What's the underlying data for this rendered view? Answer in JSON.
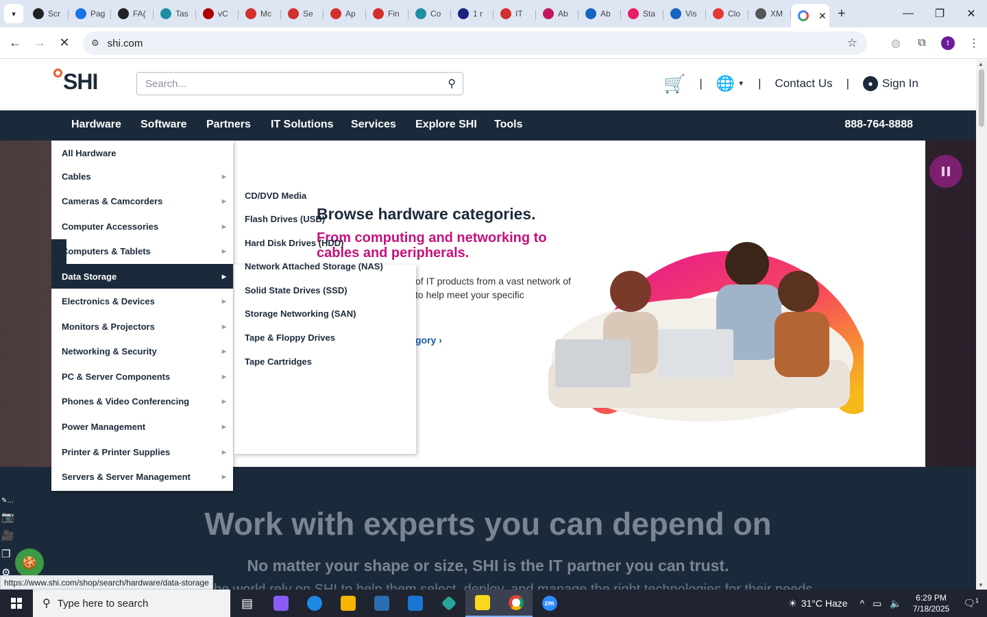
{
  "browser": {
    "tabs": [
      {
        "label": "Scr",
        "icon": "generic-icon",
        "color": "#222"
      },
      {
        "label": "Pag",
        "icon": "cloud-icon",
        "color": "#1a73e8"
      },
      {
        "label": "FA(",
        "icon": "generic-icon",
        "color": "#222"
      },
      {
        "label": "Tas",
        "icon": "circle-icon",
        "color": "#1e8fa3"
      },
      {
        "label": "vC",
        "icon": "v-icon",
        "color": "#a00"
      },
      {
        "label": "Mc",
        "icon": "diamond-icon",
        "color": "#d32f2f"
      },
      {
        "label": "Se",
        "icon": "diamond-icon",
        "color": "#d32f2f"
      },
      {
        "label": "Ap",
        "icon": "diamond-icon",
        "color": "#d32f2f"
      },
      {
        "label": "Fin",
        "icon": "diamond-icon",
        "color": "#d32f2f"
      },
      {
        "label": "Co",
        "icon": "circle-icon",
        "color": "#1e8fa3"
      },
      {
        "label": "1 r",
        "icon": "x-icon",
        "color": "#1a237e"
      },
      {
        "label": "IT",
        "icon": "diamond-icon",
        "color": "#d32f2f"
      },
      {
        "label": "Ab",
        "icon": "flower-icon",
        "color": "#c2185b"
      },
      {
        "label": "Ab",
        "icon": "scale-icon",
        "color": "#1565c0"
      },
      {
        "label": "Sta",
        "icon": "pen-icon",
        "color": "#e91e63"
      },
      {
        "label": "Vis",
        "icon": "pulse-icon",
        "color": "#1565c0"
      },
      {
        "label": "Clo",
        "icon": "sign-icon",
        "color": "#e53935"
      },
      {
        "label": "XM",
        "icon": "globe-icon",
        "color": "#555"
      }
    ],
    "active_tab_close": "✕",
    "new_tab": "+",
    "url": "shi.com",
    "profile_initial": "t"
  },
  "site": {
    "logo_text": "SHI",
    "search_placeholder": "Search...",
    "contact": "Contact Us",
    "sign_in": "Sign In",
    "phone": "888-764-8888",
    "nav": [
      "Hardware",
      "Software",
      "Partners",
      "IT Solutions",
      "Services",
      "Explore SHI",
      "Tools"
    ]
  },
  "menu": {
    "items": [
      "All Hardware",
      "Cables",
      "Cameras & Camcorders",
      "Computer Accessories",
      "Computers & Tablets",
      "Data Storage",
      "Electronics & Devices",
      "Monitors & Projectors",
      "Networking & Security",
      "PC & Server Components",
      "Phones & Video Conferencing",
      "Power Management",
      "Printer & Printer Supplies",
      "Servers & Server Management"
    ],
    "active_index": 5,
    "sub_items": [
      "CD/DVD Media",
      "Flash Drives (USB)",
      "Hard Disk Drives (HDD)",
      "Network Attached Storage (NAS)",
      "Solid State Drives (SSD)",
      "Storage Networking (SAN)",
      "Tape & Floppy Drives",
      "Tape Cartridges"
    ]
  },
  "hero": {
    "heading": "Browse hardware categories.",
    "subheading": "From computing and networking to cables and peripherals.",
    "body_line1": "of IT products from a vast network of",
    "body_line2": "to help meet your specific",
    "link": "gory"
  },
  "lower": {
    "heading": "Work with experts you can depend on",
    "sub": "No matter your shape or size, SHI is the IT partner you can trust.",
    "cut": "around the world rely on SHI to help them select, deploy, and manage the right technologies for their needs"
  },
  "status_url": "https://www.shi.com/shop/search/hardware/data-storage",
  "taskbar": {
    "search_placeholder": "Type here to search",
    "weather": "31°C  Haze",
    "time": "6:29 PM",
    "date": "7/18/2025",
    "notification_count": "1"
  },
  "colors": {
    "navy": "#1b2a3a",
    "magenta": "#c4117a",
    "brand_orange": "#f15a24"
  }
}
